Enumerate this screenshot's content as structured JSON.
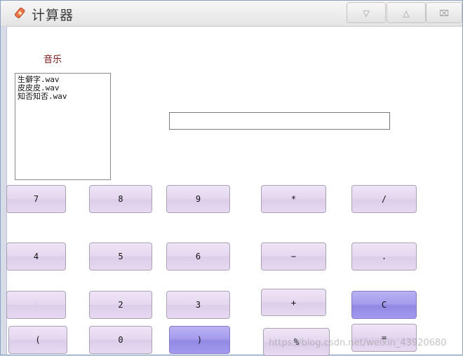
{
  "window": {
    "title": "计算器",
    "controls": {
      "minimize_glyph": "▽",
      "maximize_glyph": "△",
      "close_glyph": "⌧"
    }
  },
  "music": {
    "label": "音乐",
    "items": [
      "生僻字.wav",
      "皮皮皮.wav",
      "知否知否.wav"
    ]
  },
  "display": {
    "value": ""
  },
  "buttons": {
    "k7": "7",
    "k8": "8",
    "k9": "9",
    "mul": "*",
    "div": "/",
    "k4": "4",
    "k5": "5",
    "k6": "6",
    "sub": "−",
    "dot": ".",
    "k1": "1",
    "k2": "2",
    "k3": "3",
    "add": "+",
    "clear": "C",
    "lparen": "(",
    "k0": "0",
    "rparen": ")",
    "mod": "%",
    "eq": "="
  },
  "watermark": "https://blog.csdn.net/weixin_43920680",
  "colors": {
    "button": "#e4d7ef",
    "button_active": "#a69ced",
    "label": "#7a1414"
  }
}
